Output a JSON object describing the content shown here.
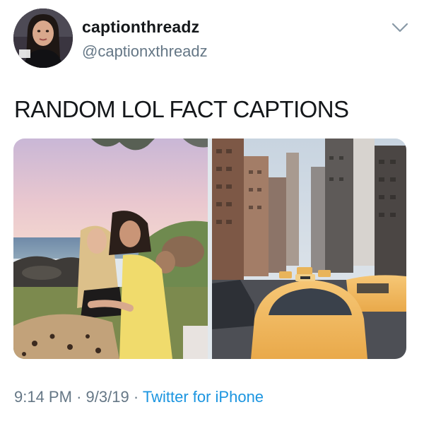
{
  "user": {
    "display_name": "captionthreadz",
    "handle": "@captionxthreadz"
  },
  "tweet": {
    "text": "RANDOM LOL FACT CAPTIONS",
    "time": "9:14 PM",
    "separator": "·",
    "date": "9/3/19",
    "source": "Twitter for iPhone"
  },
  "icons": {
    "chevron": "chevron-down-icon"
  },
  "colors": {
    "text_primary": "#14171a",
    "text_secondary": "#657786",
    "link": "#1b95e0",
    "taxi": "#f2b95b"
  },
  "media": [
    {
      "kind": "photo",
      "subject": "two women hugging on grass by the sea"
    },
    {
      "kind": "photo",
      "subject": "city street filled with yellow taxis"
    }
  ]
}
